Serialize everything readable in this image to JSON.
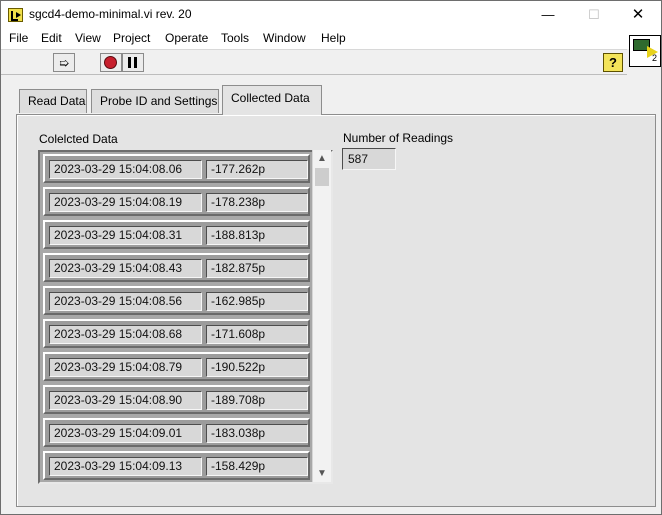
{
  "window": {
    "title": "sgcd4-demo-minimal.vi rev. 20",
    "minimize": "—",
    "maximize": "☐",
    "close": "✕"
  },
  "menu": [
    "File",
    "Edit",
    "View",
    "Project",
    "Operate",
    "Tools",
    "Window",
    "Help"
  ],
  "toolbar": {
    "run_icon": "run-continuously-icon",
    "abort_icon": "abort-execution-icon",
    "pause_icon": "pause-icon",
    "help_label": "?",
    "vi_icon_number": "2"
  },
  "tabs": {
    "read_data": "Read Data",
    "probe": "Probe ID and Settings",
    "collected": "Collected Data",
    "active": "Collected Data"
  },
  "collected": {
    "array_label": "Colelcted Data",
    "readings_label": "Number of Readings",
    "readings_value": "587",
    "rows": [
      {
        "timestamp": "2023-03-29 15:04:08.06",
        "value": "-177.262p"
      },
      {
        "timestamp": "2023-03-29 15:04:08.19",
        "value": "-178.238p"
      },
      {
        "timestamp": "2023-03-29 15:04:08.31",
        "value": "-188.813p"
      },
      {
        "timestamp": "2023-03-29 15:04:08.43",
        "value": "-182.875p"
      },
      {
        "timestamp": "2023-03-29 15:04:08.56",
        "value": "-162.985p"
      },
      {
        "timestamp": "2023-03-29 15:04:08.68",
        "value": "-171.608p"
      },
      {
        "timestamp": "2023-03-29 15:04:08.79",
        "value": "-190.522p"
      },
      {
        "timestamp": "2023-03-29 15:04:08.90",
        "value": "-189.708p"
      },
      {
        "timestamp": "2023-03-29 15:04:09.01",
        "value": "-183.038p"
      },
      {
        "timestamp": "2023-03-29 15:04:09.13",
        "value": "-158.429p"
      }
    ]
  },
  "colors": {
    "window_bg": "#f0f0f0",
    "panel_bg": "#e4e4e4",
    "abort_red": "#c71f2d",
    "help_yellow": "#f3e45a"
  }
}
